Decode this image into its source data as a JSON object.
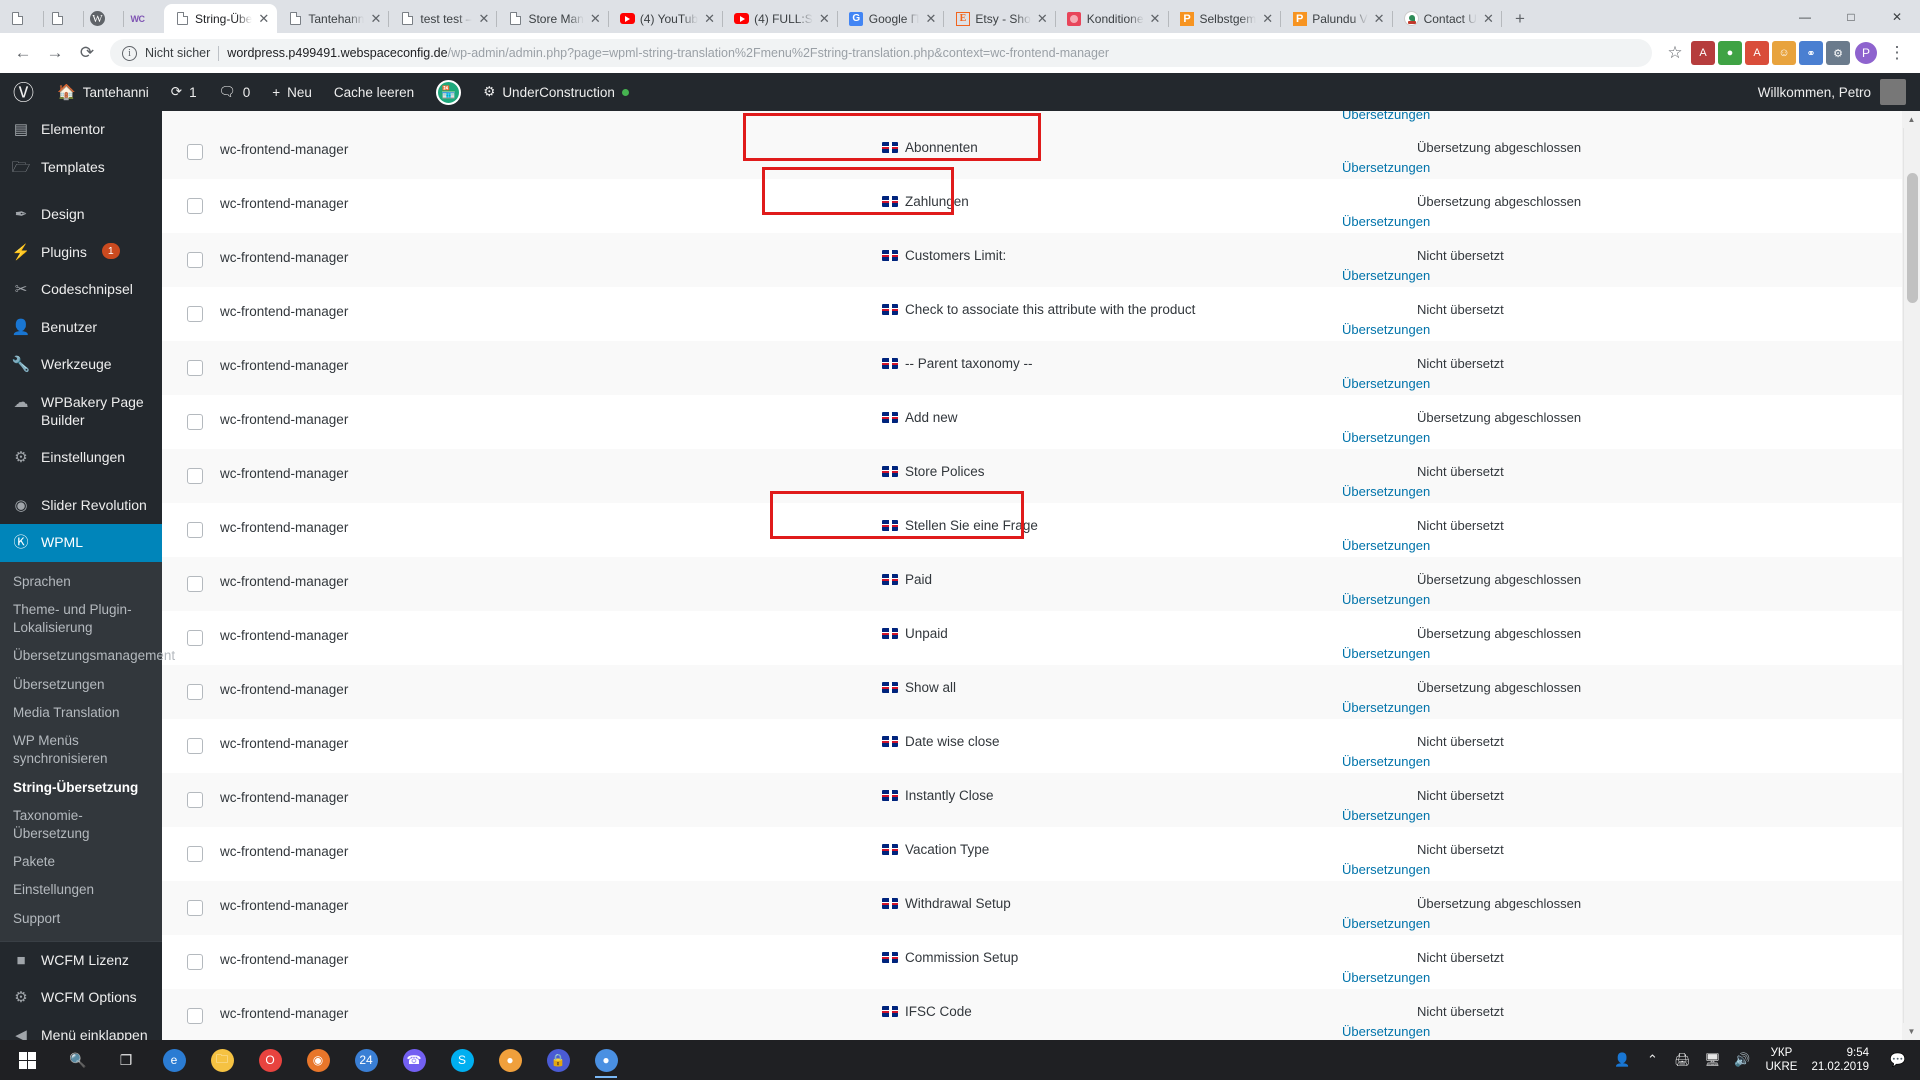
{
  "browser": {
    "tabs": [
      {
        "title": "",
        "favicon": "page-icon",
        "active": false
      },
      {
        "title": "",
        "favicon": "page-icon",
        "active": false
      },
      {
        "title": "",
        "favicon": "wordpress-icon",
        "active": false
      },
      {
        "title": "",
        "favicon": "woocommerce-icon",
        "active": false
      },
      {
        "title": "String-Übe",
        "favicon": "page-icon",
        "active": true
      },
      {
        "title": "Tantehann",
        "favicon": "page-icon",
        "active": false
      },
      {
        "title": "test test –",
        "favicon": "page-icon",
        "active": false
      },
      {
        "title": "Store Man",
        "favicon": "page-icon",
        "active": false
      },
      {
        "title": "(4) YouTub",
        "favicon": "youtube-icon",
        "active": false
      },
      {
        "title": "(4) FULL:S",
        "favicon": "youtube-icon",
        "active": false
      },
      {
        "title": "Google П",
        "favicon": "google-icon",
        "active": false
      },
      {
        "title": "Etsy - Sho",
        "favicon": "etsy-icon",
        "active": false
      },
      {
        "title": "Konditione",
        "favicon": "konditionen-icon",
        "active": false
      },
      {
        "title": "Selbstgem",
        "favicon": "palundu-icon",
        "active": false
      },
      {
        "title": "Palundu V",
        "favicon": "palundu-icon",
        "active": false
      },
      {
        "title": "Contact U",
        "favicon": "contact-icon",
        "active": false
      }
    ],
    "new_tab_label": "+",
    "window_controls": {
      "minimize": "—",
      "maximize": "□",
      "close": "✕"
    },
    "toolbar": {
      "back": "←",
      "forward": "→",
      "reload": "⟳",
      "security_label": "Nicht sicher",
      "url_domain": "wordpress.p499491.webspaceconfig.de",
      "url_path": "/wp-admin/admin.php?page=wpml-string-translation%2Fmenu%2Fstring-translation.php&context=wc-frontend-manager",
      "star": "☆",
      "profile_initial": "P",
      "menu": "⋮",
      "extensions": [
        {
          "name": "pdf-extension-icon",
          "glyph": "A",
          "color": "#b63d3d"
        },
        {
          "name": "shield-extension-icon",
          "glyph": "●",
          "color": "#3fa344"
        },
        {
          "name": "adblock-extension-icon",
          "glyph": "A",
          "color": "#d94d3a"
        },
        {
          "name": "smiley-extension-icon",
          "glyph": "☺",
          "color": "#e8a33d"
        },
        {
          "name": "link-extension-icon",
          "glyph": "⚭",
          "color": "#4a7fd1"
        },
        {
          "name": "gear-extension-icon",
          "glyph": "⚙",
          "color": "#6b7b8c"
        }
      ]
    }
  },
  "wp_admin_bar": {
    "logo": "W",
    "site_name": "Tantehanni",
    "updates_count": "1",
    "comments_count": "0",
    "new_label": "Neu",
    "cache_label": "Cache leeren",
    "wcfm_badge": "🏪",
    "underconstruction_label": "UnderConstruction",
    "greeting": "Willkommen, Petro"
  },
  "wp_menu": {
    "items": [
      {
        "label": "Elementor",
        "icon": "elementor-icon",
        "glyph": "▤",
        "sep": false
      },
      {
        "label": "Templates",
        "icon": "templates-folder-icon",
        "glyph": "🗁",
        "sep": false
      },
      {
        "label": "Design",
        "icon": "appearance-brush-icon",
        "glyph": "✒",
        "sep": true
      },
      {
        "label": "Plugins",
        "icon": "plugins-plug-icon",
        "glyph": "⚡",
        "badge": "1",
        "sep": false
      },
      {
        "label": "Codeschnipsel",
        "icon": "scissors-icon",
        "glyph": "✂",
        "sep": false
      },
      {
        "label": "Benutzer",
        "icon": "users-icon",
        "glyph": "👤",
        "sep": false
      },
      {
        "label": "Werkzeuge",
        "icon": "tools-wrench-icon",
        "glyph": "🔧",
        "sep": false
      },
      {
        "label": "WPBakery Page Builder",
        "icon": "wpbakery-icon",
        "glyph": "☁",
        "sep": false
      },
      {
        "label": "Einstellungen",
        "icon": "settings-sliders-icon",
        "glyph": "⚙",
        "sep": false
      },
      {
        "label": "Slider Revolution",
        "icon": "slider-revolution-icon",
        "glyph": "◉",
        "sep": true
      },
      {
        "label": "WPML",
        "icon": "wpml-icon",
        "glyph": "Ⓚ",
        "current": true,
        "sep": false
      }
    ],
    "submenu": [
      {
        "label": "Sprachen",
        "active": false
      },
      {
        "label": "Theme- und Plugin-Lokalisierung",
        "active": false
      },
      {
        "label": "Übersetzungsmanagement",
        "active": false
      },
      {
        "label": "Übersetzungen",
        "active": false
      },
      {
        "label": "Media Translation",
        "active": false
      },
      {
        "label": "WP Menüs synchronisieren",
        "active": false
      },
      {
        "label": "String-Übersetzung",
        "active": true
      },
      {
        "label": "Taxonomie-Übersetzung",
        "active": false
      },
      {
        "label": "Pakete",
        "active": false
      },
      {
        "label": "Einstellungen",
        "active": false
      },
      {
        "label": "Support",
        "active": false
      }
    ],
    "bottom_items": [
      {
        "label": "WCFM Lizenz",
        "icon": "wcfm-license-icon",
        "glyph": "■"
      },
      {
        "label": "WCFM Options",
        "icon": "wcfm-options-gear-icon",
        "glyph": "⚙"
      },
      {
        "label": "Menü einklappen",
        "icon": "collapse-arrow-icon",
        "glyph": "◀"
      }
    ]
  },
  "table": {
    "translations_link": "Übersetzungen",
    "status_done": "Übersetzung abgeschlossen",
    "status_untranslated": "Nicht übersetzt",
    "flag": "en-flag-icon",
    "top_partial_link": "Übersetzungen",
    "rows": [
      {
        "context": "wc-frontend-manager",
        "string": "Abonnenten",
        "status": "Übersetzung abgeschlossen",
        "highlight": "wide"
      },
      {
        "context": "wc-frontend-manager",
        "string": "Zahlungen",
        "status": "Übersetzung abgeschlossen",
        "highlight": "narrow"
      },
      {
        "context": "wc-frontend-manager",
        "string": "Customers Limit:",
        "status": "Nicht übersetzt",
        "highlight": null
      },
      {
        "context": "wc-frontend-manager",
        "string": "Check to associate this attribute with the product",
        "status": "Nicht übersetzt",
        "highlight": null
      },
      {
        "context": "wc-frontend-manager",
        "string": "-- Parent taxonomy --",
        "status": "Nicht übersetzt",
        "highlight": null
      },
      {
        "context": "wc-frontend-manager",
        "string": "Add new",
        "status": "Übersetzung abgeschlossen",
        "highlight": null
      },
      {
        "context": "wc-frontend-manager",
        "string": "Store Polices",
        "status": "Nicht übersetzt",
        "highlight": null
      },
      {
        "context": "wc-frontend-manager",
        "string": "Stellen Sie eine Frage",
        "status": "Nicht übersetzt",
        "highlight": "medium"
      },
      {
        "context": "wc-frontend-manager",
        "string": "Paid",
        "status": "Übersetzung abgeschlossen",
        "highlight": null
      },
      {
        "context": "wc-frontend-manager",
        "string": "Unpaid",
        "status": "Übersetzung abgeschlossen",
        "highlight": null
      },
      {
        "context": "wc-frontend-manager",
        "string": "Show all",
        "status": "Übersetzung abgeschlossen",
        "highlight": null
      },
      {
        "context": "wc-frontend-manager",
        "string": "Date wise close",
        "status": "Nicht übersetzt",
        "highlight": null
      },
      {
        "context": "wc-frontend-manager",
        "string": "Instantly Close",
        "status": "Nicht übersetzt",
        "highlight": null
      },
      {
        "context": "wc-frontend-manager",
        "string": "Vacation Type",
        "status": "Nicht übersetzt",
        "highlight": null
      },
      {
        "context": "wc-frontend-manager",
        "string": "Withdrawal Setup",
        "status": "Übersetzung abgeschlossen",
        "highlight": null
      },
      {
        "context": "wc-frontend-manager",
        "string": "Commission Setup",
        "status": "Nicht übersetzt",
        "highlight": null
      },
      {
        "context": "wc-frontend-manager",
        "string": "IFSC Code",
        "status": "Nicht übersetzt",
        "highlight": null
      }
    ]
  },
  "taskbar": {
    "start": "start-button",
    "search": "🔍",
    "taskview": "❐",
    "apps": [
      {
        "name": "edge-icon",
        "glyph": "e",
        "color": "#2b7cd3",
        "open": false
      },
      {
        "name": "file-explorer-icon",
        "glyph": "🗀",
        "color": "#f5c242",
        "open": false
      },
      {
        "name": "opera-icon",
        "glyph": "O",
        "color": "#e8433f",
        "open": false
      },
      {
        "name": "firefox-icon",
        "glyph": "◉",
        "color": "#e8762a",
        "open": false
      },
      {
        "name": "media-player-icon",
        "glyph": "24",
        "color": "#3a7fd5",
        "open": false
      },
      {
        "name": "viber-icon",
        "glyph": "☎",
        "color": "#7360f2",
        "open": false
      },
      {
        "name": "skype-icon",
        "glyph": "S",
        "color": "#00aff0",
        "open": false
      },
      {
        "name": "photos-icon",
        "glyph": "●",
        "color": "#f0a03c",
        "open": false
      },
      {
        "name": "lock-app-icon",
        "glyph": "🔒",
        "color": "#4a5bd4",
        "open": false
      },
      {
        "name": "chrome-icon",
        "glyph": "●",
        "color": "#4a90e2",
        "open": true
      }
    ],
    "tray": {
      "people": "👤",
      "chevron_up": "⌃",
      "print": "🖨",
      "monitor": "🖥",
      "volume": "🔊",
      "lang_line1": "УКР",
      "lang_line2": "UKRE",
      "time": "9:54",
      "date": "21.02.2019",
      "notification": "💬"
    }
  }
}
